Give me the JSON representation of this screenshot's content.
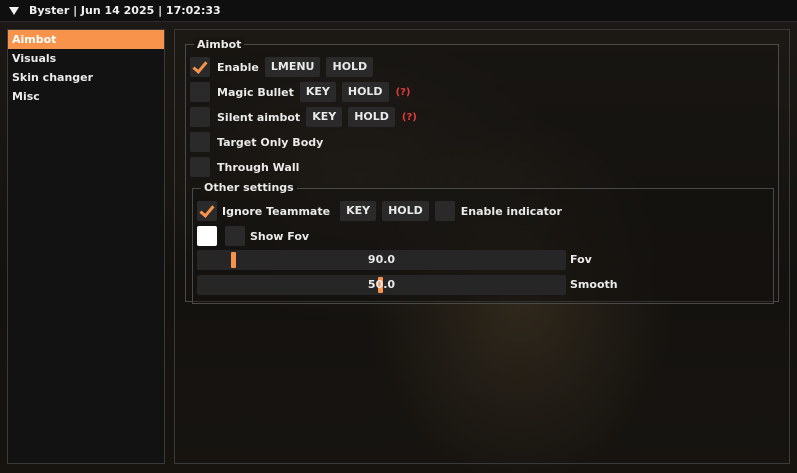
{
  "window": {
    "title": "Byster | Jun 14 2025 | 17:02:33"
  },
  "sidebar": {
    "items": [
      {
        "label": "Aimbot",
        "active": true
      },
      {
        "label": "Visuals",
        "active": false
      },
      {
        "label": "Skin changer",
        "active": false
      },
      {
        "label": "Misc",
        "active": false
      }
    ]
  },
  "aimbot": {
    "title": "Aimbot",
    "enable": {
      "label": "Enable",
      "checked": true,
      "key": "LMENU",
      "mode": "HOLD"
    },
    "magic_bullet": {
      "label": "Magic Bullet",
      "checked": false,
      "key": "KEY",
      "mode": "HOLD",
      "hint": "(?)"
    },
    "silent_aimbot": {
      "label": "Silent aimbot",
      "checked": false,
      "key": "KEY",
      "mode": "HOLD",
      "hint": "(?)"
    },
    "target_only_body": {
      "label": "Target Only Body",
      "checked": false
    },
    "through_wall": {
      "label": "Through Wall",
      "checked": false
    }
  },
  "other_settings": {
    "title": "Other settings",
    "ignore_teammate": {
      "label": "Ignore Teammate",
      "checked": true,
      "key": "KEY",
      "mode": "HOLD"
    },
    "enable_indicator": {
      "label": "Enable indicator",
      "checked": false
    },
    "show_fov": {
      "label": "Show Fov",
      "color_swatch": "#ffffff",
      "checked": false
    },
    "fov_slider": {
      "label": "Fov",
      "value": "90.0",
      "fraction": 0.1
    },
    "smooth_slider": {
      "label": "Smooth",
      "value": "50.0",
      "fraction": 0.5
    }
  },
  "colors": {
    "accent": "#f7934a",
    "warning": "#e23b3b"
  }
}
